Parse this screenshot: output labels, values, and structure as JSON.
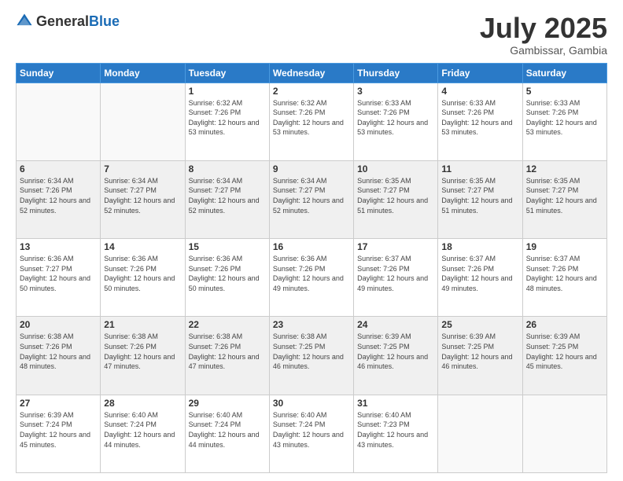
{
  "header": {
    "logo": {
      "general": "General",
      "blue": "Blue"
    },
    "title": "July 2025",
    "location": "Gambissar, Gambia"
  },
  "days_of_week": [
    "Sunday",
    "Monday",
    "Tuesday",
    "Wednesday",
    "Thursday",
    "Friday",
    "Saturday"
  ],
  "weeks": [
    {
      "shaded": false,
      "days": [
        {
          "num": "",
          "info": ""
        },
        {
          "num": "",
          "info": ""
        },
        {
          "num": "1",
          "info": "Sunrise: 6:32 AM\nSunset: 7:26 PM\nDaylight: 12 hours and 53 minutes."
        },
        {
          "num": "2",
          "info": "Sunrise: 6:32 AM\nSunset: 7:26 PM\nDaylight: 12 hours and 53 minutes."
        },
        {
          "num": "3",
          "info": "Sunrise: 6:33 AM\nSunset: 7:26 PM\nDaylight: 12 hours and 53 minutes."
        },
        {
          "num": "4",
          "info": "Sunrise: 6:33 AM\nSunset: 7:26 PM\nDaylight: 12 hours and 53 minutes."
        },
        {
          "num": "5",
          "info": "Sunrise: 6:33 AM\nSunset: 7:26 PM\nDaylight: 12 hours and 53 minutes."
        }
      ]
    },
    {
      "shaded": true,
      "days": [
        {
          "num": "6",
          "info": "Sunrise: 6:34 AM\nSunset: 7:26 PM\nDaylight: 12 hours and 52 minutes."
        },
        {
          "num": "7",
          "info": "Sunrise: 6:34 AM\nSunset: 7:27 PM\nDaylight: 12 hours and 52 minutes."
        },
        {
          "num": "8",
          "info": "Sunrise: 6:34 AM\nSunset: 7:27 PM\nDaylight: 12 hours and 52 minutes."
        },
        {
          "num": "9",
          "info": "Sunrise: 6:34 AM\nSunset: 7:27 PM\nDaylight: 12 hours and 52 minutes."
        },
        {
          "num": "10",
          "info": "Sunrise: 6:35 AM\nSunset: 7:27 PM\nDaylight: 12 hours and 51 minutes."
        },
        {
          "num": "11",
          "info": "Sunrise: 6:35 AM\nSunset: 7:27 PM\nDaylight: 12 hours and 51 minutes."
        },
        {
          "num": "12",
          "info": "Sunrise: 6:35 AM\nSunset: 7:27 PM\nDaylight: 12 hours and 51 minutes."
        }
      ]
    },
    {
      "shaded": false,
      "days": [
        {
          "num": "13",
          "info": "Sunrise: 6:36 AM\nSunset: 7:27 PM\nDaylight: 12 hours and 50 minutes."
        },
        {
          "num": "14",
          "info": "Sunrise: 6:36 AM\nSunset: 7:26 PM\nDaylight: 12 hours and 50 minutes."
        },
        {
          "num": "15",
          "info": "Sunrise: 6:36 AM\nSunset: 7:26 PM\nDaylight: 12 hours and 50 minutes."
        },
        {
          "num": "16",
          "info": "Sunrise: 6:36 AM\nSunset: 7:26 PM\nDaylight: 12 hours and 49 minutes."
        },
        {
          "num": "17",
          "info": "Sunrise: 6:37 AM\nSunset: 7:26 PM\nDaylight: 12 hours and 49 minutes."
        },
        {
          "num": "18",
          "info": "Sunrise: 6:37 AM\nSunset: 7:26 PM\nDaylight: 12 hours and 49 minutes."
        },
        {
          "num": "19",
          "info": "Sunrise: 6:37 AM\nSunset: 7:26 PM\nDaylight: 12 hours and 48 minutes."
        }
      ]
    },
    {
      "shaded": true,
      "days": [
        {
          "num": "20",
          "info": "Sunrise: 6:38 AM\nSunset: 7:26 PM\nDaylight: 12 hours and 48 minutes."
        },
        {
          "num": "21",
          "info": "Sunrise: 6:38 AM\nSunset: 7:26 PM\nDaylight: 12 hours and 47 minutes."
        },
        {
          "num": "22",
          "info": "Sunrise: 6:38 AM\nSunset: 7:26 PM\nDaylight: 12 hours and 47 minutes."
        },
        {
          "num": "23",
          "info": "Sunrise: 6:38 AM\nSunset: 7:25 PM\nDaylight: 12 hours and 46 minutes."
        },
        {
          "num": "24",
          "info": "Sunrise: 6:39 AM\nSunset: 7:25 PM\nDaylight: 12 hours and 46 minutes."
        },
        {
          "num": "25",
          "info": "Sunrise: 6:39 AM\nSunset: 7:25 PM\nDaylight: 12 hours and 46 minutes."
        },
        {
          "num": "26",
          "info": "Sunrise: 6:39 AM\nSunset: 7:25 PM\nDaylight: 12 hours and 45 minutes."
        }
      ]
    },
    {
      "shaded": false,
      "days": [
        {
          "num": "27",
          "info": "Sunrise: 6:39 AM\nSunset: 7:24 PM\nDaylight: 12 hours and 45 minutes."
        },
        {
          "num": "28",
          "info": "Sunrise: 6:40 AM\nSunset: 7:24 PM\nDaylight: 12 hours and 44 minutes."
        },
        {
          "num": "29",
          "info": "Sunrise: 6:40 AM\nSunset: 7:24 PM\nDaylight: 12 hours and 44 minutes."
        },
        {
          "num": "30",
          "info": "Sunrise: 6:40 AM\nSunset: 7:24 PM\nDaylight: 12 hours and 43 minutes."
        },
        {
          "num": "31",
          "info": "Sunrise: 6:40 AM\nSunset: 7:23 PM\nDaylight: 12 hours and 43 minutes."
        },
        {
          "num": "",
          "info": ""
        },
        {
          "num": "",
          "info": ""
        }
      ]
    }
  ]
}
